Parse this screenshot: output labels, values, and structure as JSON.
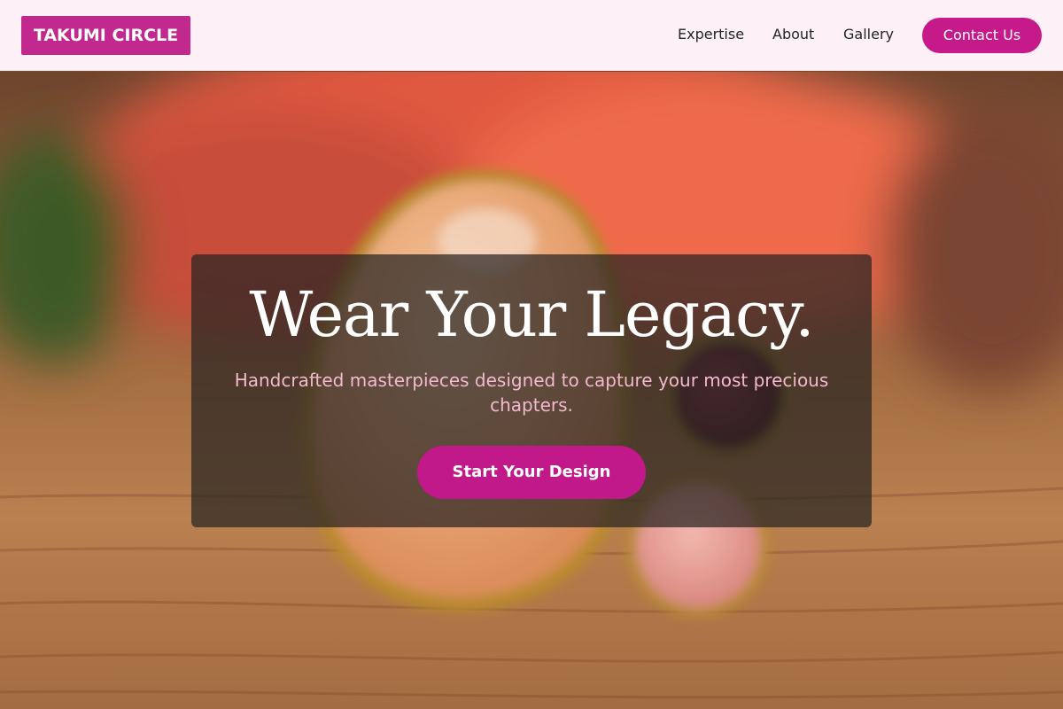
{
  "header": {
    "logo": "TAKUMI CIRCLE",
    "nav": [
      "Expertise",
      "About",
      "Gallery"
    ],
    "contact_label": "Contact Us"
  },
  "hero": {
    "headline": "Wear Your Legacy.",
    "subheadline": "Handcrafted masterpieces designed to capture your most precious chapters.",
    "cta_label": "Start Your Design",
    "image": "ring-photo"
  },
  "colors": {
    "brand": "#c2298f",
    "button": "#c61a8b",
    "header_bg": "#fdf1f7",
    "subhead_text": "#f2b9cf"
  }
}
